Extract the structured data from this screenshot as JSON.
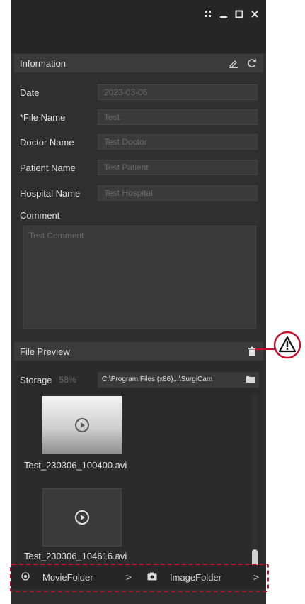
{
  "titlebar": {
    "icons": [
      "grip-icon",
      "minimize-icon",
      "maximize-icon",
      "close-icon"
    ]
  },
  "information": {
    "title": "Information",
    "fields": [
      {
        "label": "Date",
        "value": "2023-03-06"
      },
      {
        "label": "*File Name",
        "value": "Test"
      },
      {
        "label": "Doctor Name",
        "value": "Test Doctor"
      },
      {
        "label": "Patient Name",
        "value": "Test Patient"
      },
      {
        "label": "Hospital Name",
        "value": "Test Hospital"
      }
    ],
    "comment_label": "Comment",
    "comment_value": "Test Comment"
  },
  "preview": {
    "title": "File Preview",
    "storage_label": "Storage",
    "storage_percent": "58%",
    "storage_path": "C:\\Program Files (x86)...\\SurgiCam",
    "files": [
      "Test_230306_100400.avi",
      "Test_230306_104616.avi"
    ]
  },
  "bottom": {
    "movie_folder": "MovieFolder",
    "image_folder": "ImageFolder"
  },
  "colors": {
    "accent_warning": "#c8102e",
    "panel_bg": "#2e2e2e"
  }
}
